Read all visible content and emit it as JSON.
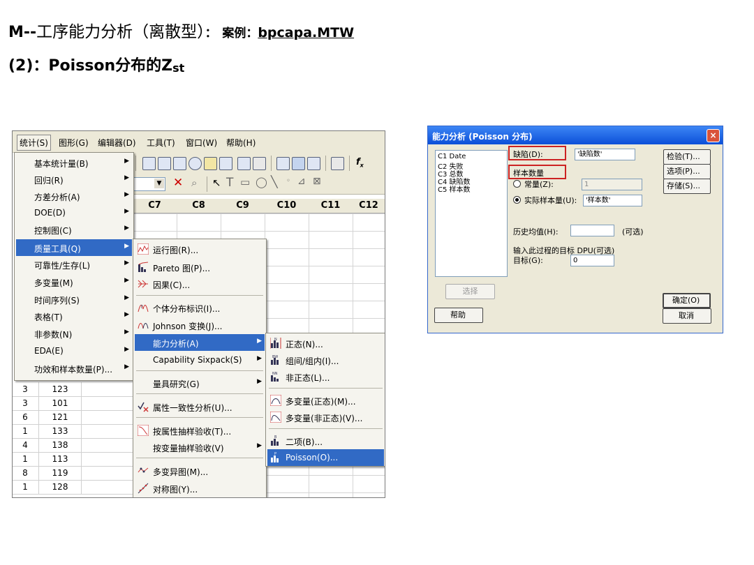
{
  "slide": {
    "title_m": "M--",
    "title_cn": "工序能力分析（离散型）",
    "title_colon": "：",
    "title_case": "案例：",
    "title_file": "bpcapa.MTW",
    "sub_prefix": "(2)：",
    "sub_main": "Poisson分布的Z",
    "sub_sub": "st"
  },
  "menubar": [
    "统计(S)",
    "图形(G)",
    "编辑器(D)",
    "工具(T)",
    "窗口(W)",
    "帮助(H)"
  ],
  "columns": [
    "C7",
    "C8",
    "C9",
    "C10",
    "C11",
    "C12"
  ],
  "stat_menu": [
    "基本统计量(B)",
    "回归(R)",
    "方差分析(A)",
    "DOE(D)",
    "控制图(C)",
    "质量工具(Q)",
    "可靠性/生存(L)",
    "多变量(M)",
    "时间序列(S)",
    "表格(T)",
    "非参数(N)",
    "EDA(E)",
    "功效和样本数量(P)..."
  ],
  "quality_menu": [
    "运行图(R)...",
    "Pareto 图(P)...",
    "因果(C)...",
    "个体分布标识(I)...",
    "Johnson 变换(J)...",
    "能力分析(A)",
    "Capability Sixpack(S)",
    "量具研究(G)",
    "属性一致性分析(U)...",
    "按属性抽样验收(T)...",
    "按变量抽样验收(V)",
    "多变异图(M)...",
    "对称图(Y)..."
  ],
  "capability_menu": [
    "正态(N)...",
    "组间/组内(I)...",
    "非正态(L)...",
    "多变量(正态)(M)...",
    "多变量(非正态)(V)...",
    "二项(B)...",
    "Poisson(O)..."
  ],
  "data_rows": [
    {
      "a": "3",
      "b": "123"
    },
    {
      "a": "3",
      "b": "101"
    },
    {
      "a": "6",
      "b": "121"
    },
    {
      "a": "1",
      "b": "133"
    },
    {
      "a": "4",
      "b": "138"
    },
    {
      "a": "1",
      "b": "113"
    },
    {
      "a": "8",
      "b": "119"
    },
    {
      "a": "1",
      "b": "128"
    }
  ],
  "dialog": {
    "title": "能力分析 (Poisson 分布)",
    "close": "×",
    "vars": [
      "C1    Date",
      "C2    失败",
      "C3    总数",
      "C4    缺陷数",
      "C5    样本数"
    ],
    "defects_label": "缺陷(D):",
    "defects_value": "'缺陷数'",
    "sample_label": "样本数量",
    "const_label": "常量(Z):",
    "const_value": "1",
    "actual_label": "实际样本量(U):",
    "actual_value": "'样本数'",
    "hist_label": "历史均值(H):",
    "optional": "(可选)",
    "target_line": "输入此过程的目标 DPU(可选)",
    "target_label": "目标(G):",
    "target_value": "0",
    "btn_check": "检验(T)...",
    "btn_options": "选项(P)...",
    "btn_store": "存储(S)...",
    "btn_select": "选择",
    "btn_help": "帮助",
    "btn_ok": "确定(O)",
    "btn_cancel": "取消"
  }
}
